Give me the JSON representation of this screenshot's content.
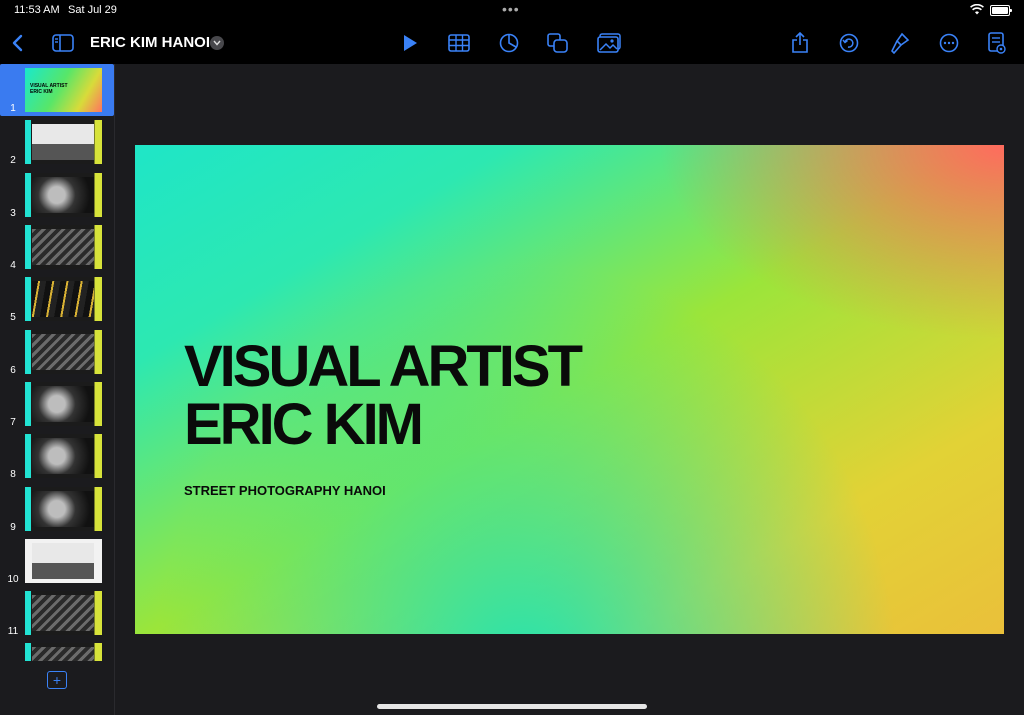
{
  "status": {
    "time": "11:53 AM",
    "date": "Sat Jul 29",
    "dots": "•••"
  },
  "toolbar": {
    "title": "ERIC KIM HANOI",
    "icons": [
      "back-icon",
      "sidebar-icon",
      "play-icon",
      "table-icon",
      "chart-icon",
      "shapes-icon",
      "media-icon",
      "share-icon",
      "undo-icon",
      "format-brush-icon",
      "more-icon",
      "presenter-view-icon"
    ],
    "accent": "#3a82f7"
  },
  "slides": [
    {
      "num": "1",
      "selected": true,
      "title_line1": "VISUAL ARTIST",
      "title_line2": "ERIC KIM"
    },
    {
      "num": "2"
    },
    {
      "num": "3"
    },
    {
      "num": "4"
    },
    {
      "num": "5"
    },
    {
      "num": "6"
    },
    {
      "num": "7"
    },
    {
      "num": "8"
    },
    {
      "num": "9"
    },
    {
      "num": "10"
    },
    {
      "num": "11"
    }
  ],
  "add_slide_icon": "plus-square-icon",
  "current_slide": {
    "title_line1": "VISUAL ARTIST",
    "title_line2": "ERIC KIM",
    "subtitle": "STREET PHOTOGRAPHY HANOI",
    "gradient": [
      "#1fe6c7",
      "#9be53a",
      "#e2d236",
      "#ff6b5e"
    ]
  }
}
